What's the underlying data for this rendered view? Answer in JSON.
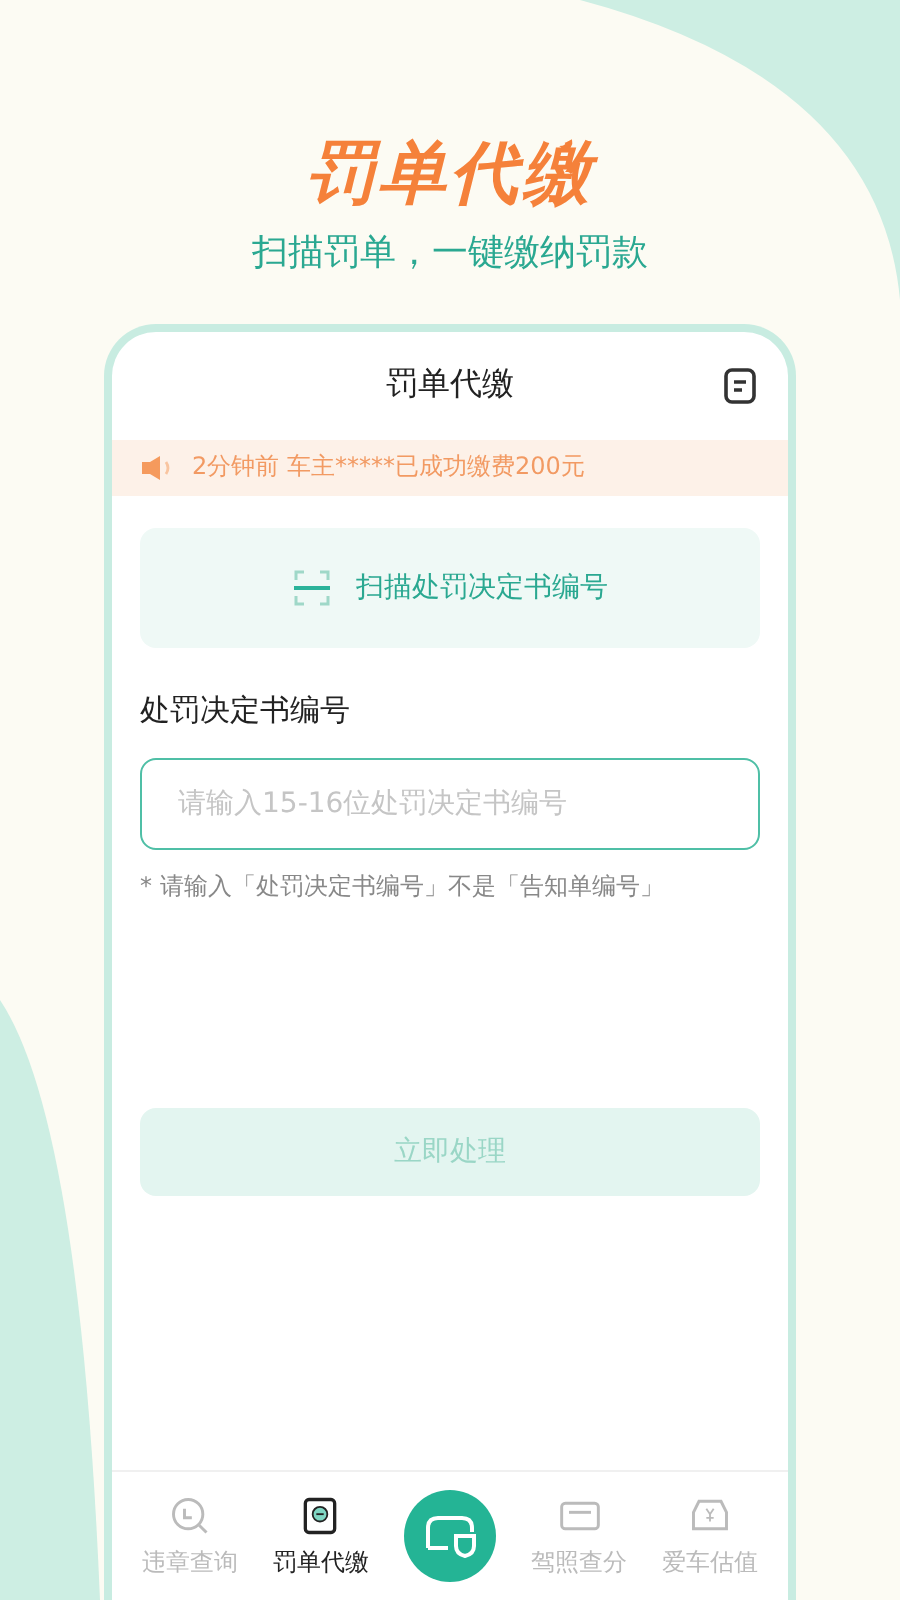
{
  "promo": {
    "headline": "罚单代缴",
    "subtitle": "扫描罚单，一键缴纳罚款"
  },
  "screen": {
    "title": "罚单代缴",
    "notice": {
      "text": "2分钟前 车主*****已成功缴费200元"
    },
    "scan_button": {
      "label": "扫描处罚决定书编号"
    },
    "field": {
      "label": "处罚决定书编号",
      "placeholder": "请输入15-16位处罚决定书编号",
      "hint": "* 请输入「处罚决定书编号」不是「告知单编号」"
    },
    "submit": {
      "label": "立即处理",
      "disabled": true
    }
  },
  "tab_bar": [
    {
      "kind": "query",
      "label": "违章查询",
      "selected": false
    },
    {
      "kind": "pay",
      "label": "罚单代缴",
      "selected": true
    },
    {
      "kind": "center",
      "selected": false
    },
    {
      "kind": "license",
      "label": "驾照查分",
      "selected": false
    },
    {
      "kind": "value",
      "label": "爱车估值",
      "selected": false
    }
  ]
}
